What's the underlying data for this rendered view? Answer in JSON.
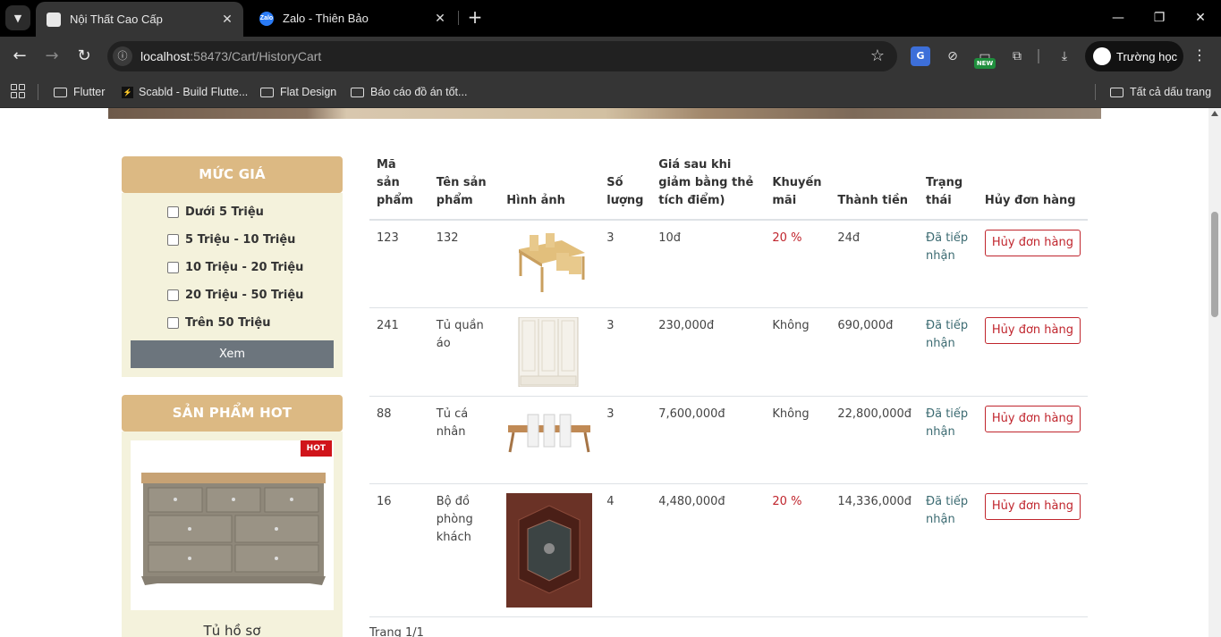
{
  "browser": {
    "tabs": [
      {
        "title": "Nội Thất Cao Cấp",
        "active": true
      },
      {
        "title": "Zalo - Thiên Bảo",
        "active": false
      }
    ],
    "url": {
      "host": "localhost",
      "path": ":58473/Cart/HistoryCart"
    },
    "profile_name": "Trường học",
    "ext_new_badge": "NEW",
    "bookmarks": [
      "Flutter",
      "Scabld - Build Flutte...",
      "Flat Design",
      "Báo cáo đồ án tốt..."
    ],
    "all_bookmarks": "Tất cả dấu trang"
  },
  "sidebar": {
    "price_title": "MỨC GIÁ",
    "price_options": [
      "Dưới 5 Triệu",
      "5 Triệu - 10 Triệu",
      "10 Triệu - 20 Triệu",
      "20 Triệu - 50 Triệu",
      "Trên 50 Triệu"
    ],
    "view_button": "Xem",
    "hot_title": "SẢN PHẨM HOT",
    "hot_badge": "HOT",
    "hot_product_name": "Tủ hồ sơ"
  },
  "table": {
    "headers": [
      "Mã sản phẩm",
      "Tên sản phẩm",
      "Hình ảnh",
      "Số lượng",
      "Giá sau khi giảm bằng thẻ tích điểm)",
      "Khuyến mãi",
      "Thành tiền",
      "Trạng thái",
      "Hủy đơn hàng"
    ],
    "rows": [
      {
        "id": "123",
        "name": "132",
        "image": "dining-table-image",
        "qty": "3",
        "price": "10đ",
        "promo": "20 %",
        "promo_highlight": true,
        "total": "24đ",
        "status": "Đã tiếp nhận",
        "cancel": "Hủy đơn hàng"
      },
      {
        "id": "241",
        "name": "Tủ quần áo",
        "image": "wardrobe-image",
        "qty": "3",
        "price": "230,000đ",
        "promo": "Không",
        "promo_highlight": false,
        "total": "690,000đ",
        "status": "Đã tiếp nhận",
        "cancel": "Hủy đơn hàng"
      },
      {
        "id": "88",
        "name": "Tủ cá nhân",
        "image": "table-chairs-image",
        "qty": "3",
        "price": "7,600,000đ",
        "promo": "Không",
        "promo_highlight": false,
        "total": "22,800,000đ",
        "status": "Đã tiếp nhận",
        "cancel": "Hủy đơn hàng"
      },
      {
        "id": "16",
        "name": "Bộ đồ phòng khách",
        "image": "living-room-set-image",
        "qty": "4",
        "price": "4,480,000đ",
        "promo": "20 %",
        "promo_highlight": true,
        "total": "14,336,000đ",
        "status": "Đã tiếp nhận",
        "cancel": "Hủy đơn hàng"
      }
    ]
  },
  "pagination": "Trang 1/1",
  "colors": {
    "accent_tan": "#dcb983",
    "panel_bg": "#f4f2dc",
    "danger": "#c0252d",
    "status": "#3c6b72"
  }
}
